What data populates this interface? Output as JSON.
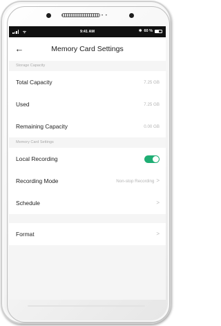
{
  "status_bar": {
    "time": "9:41 AM",
    "battery_text": "60 %",
    "bluetooth_glyph": "✱",
    "wifi_glyph": "ᯤ"
  },
  "header": {
    "back_glyph": "←",
    "title": "Memory Card Settings"
  },
  "storage": {
    "section_label": "Storage Capacity",
    "total_label": "Total Capacity",
    "total_value": "7.25 GB",
    "used_label": "Used",
    "used_value": "7.25 GB",
    "remaining_label": "Remaining Capacity",
    "remaining_value": "0.00 GB"
  },
  "memory_card": {
    "section_label": "Memory Card Settings",
    "local_recording_label": "Local Recording",
    "local_recording_on": true,
    "recording_mode_label": "Recording Mode",
    "recording_mode_value": "Non-stop Recording",
    "schedule_label": "Schedule",
    "chevron_glyph": ">"
  },
  "format": {
    "label": "Format"
  },
  "colors": {
    "toggle_on": "#1fae74",
    "screen_bg": "#f5f5f5",
    "status_bar_bg": "#111111"
  }
}
